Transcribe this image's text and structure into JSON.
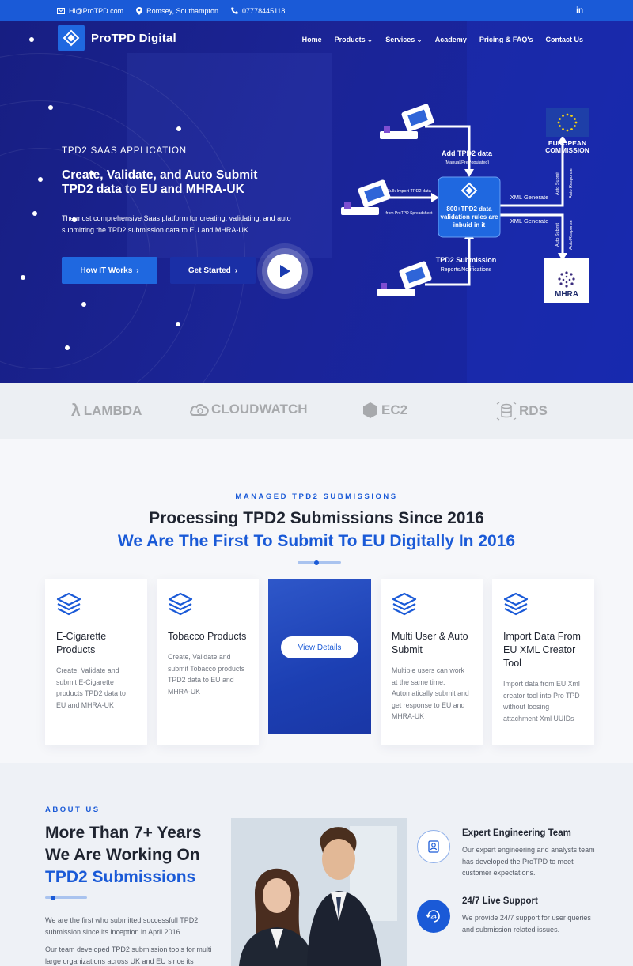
{
  "topbar": {
    "email": "Hi@ProTPD.com",
    "location": "Romsey, Southampton",
    "phone": "07778445118",
    "social": "in"
  },
  "brand": {
    "name": "ProTPD Digital"
  },
  "nav": {
    "items": [
      {
        "label": "Home"
      },
      {
        "label": "Products"
      },
      {
        "label": "Services"
      },
      {
        "label": "Academy"
      },
      {
        "label": "Pricing & FAQ's"
      },
      {
        "label": "Contact Us"
      }
    ]
  },
  "hero": {
    "eyebrow": "TPD2 SAAS APPLICATION",
    "headline_line1": "Create, Validate, and Auto Submit",
    "headline_line2": "TPD2 data to EU and MHRA-UK",
    "subtitle": "The most comprehensive Saas platform for creating, validating, and auto submitting the TPD2 submission data to EU and MHRA-UK",
    "primary_button": "How IT Works",
    "secondary_button": "Get Started"
  },
  "diagram": {
    "add_label": "Add TPD2 data",
    "add_sub": "(Manual/PrePopulated)",
    "bulk_label": "Bulk Import TPD2 data",
    "bulk_sub": "from ProTPD Spreadsheet",
    "center_label": "800+TPD2 data validation rules are inbuid in it",
    "xml1": "XML Generate",
    "xml2": "XML Generate",
    "submission_label": "TPD2 Submission",
    "submission_sub": "Reports/Notifications",
    "auto_submit": "Auto Submit",
    "auto_response": "Auto Response",
    "ec_label": "EUROPEAN COMMISSION",
    "mhra_label": "MHRA"
  },
  "partners": [
    "LAMBDA",
    "CLOUDWATCH",
    "EC2",
    "RDS"
  ],
  "managed": {
    "eyebrow": "MANAGED TPD2 SUBMISSIONS",
    "title": "Processing TPD2 Submissions Since 2016",
    "subtitle": "We Are The First To Submit To EU Digitally In 2016",
    "cards": [
      {
        "title": "E-Cigarette Products",
        "desc": "Create, Validate and submit E-Cigarette products TPD2 data to EU and MHRA-UK"
      },
      {
        "title": "Tobacco Products",
        "desc": "Create, Validate and submit Tobacco products TPD2 data to EU and MHRA-UK"
      },
      {
        "title": "Multi User & Auto Submit",
        "desc": "Multiple users can work at the same time. Automatically submit and get response to EU and MHRA-UK"
      },
      {
        "title": "Import Data From EU XML Creator Tool",
        "desc": "Import data from EU Xml creator tool into Pro TPD without loosing attachment Xml UUIDs"
      }
    ],
    "view_details": "View Details"
  },
  "about": {
    "eyebrow": "ABOUT US",
    "title_line1": "More Than 7+ Years",
    "title_line2": "We Are Working On",
    "title_line3": "TPD2 Submissions",
    "p1": "We are the first who submitted successfull TPD2 submission since its inception in April 2016.",
    "p2": "Our team developed TPD2 submission tools for multi large organizations across UK and EU since its",
    "features": [
      {
        "title": "Expert Engineering Team",
        "desc": "Our expert engineering and analysts team has developed the ProTPD to meet customer expectations."
      },
      {
        "title": "24/7 Live Support",
        "desc": "We provide 24/7 support for user queries and submission related issues."
      }
    ]
  },
  "colors": {
    "primary": "#1a5ad7",
    "hero_bg": "#1b2496",
    "dark_text": "#1f2430"
  }
}
